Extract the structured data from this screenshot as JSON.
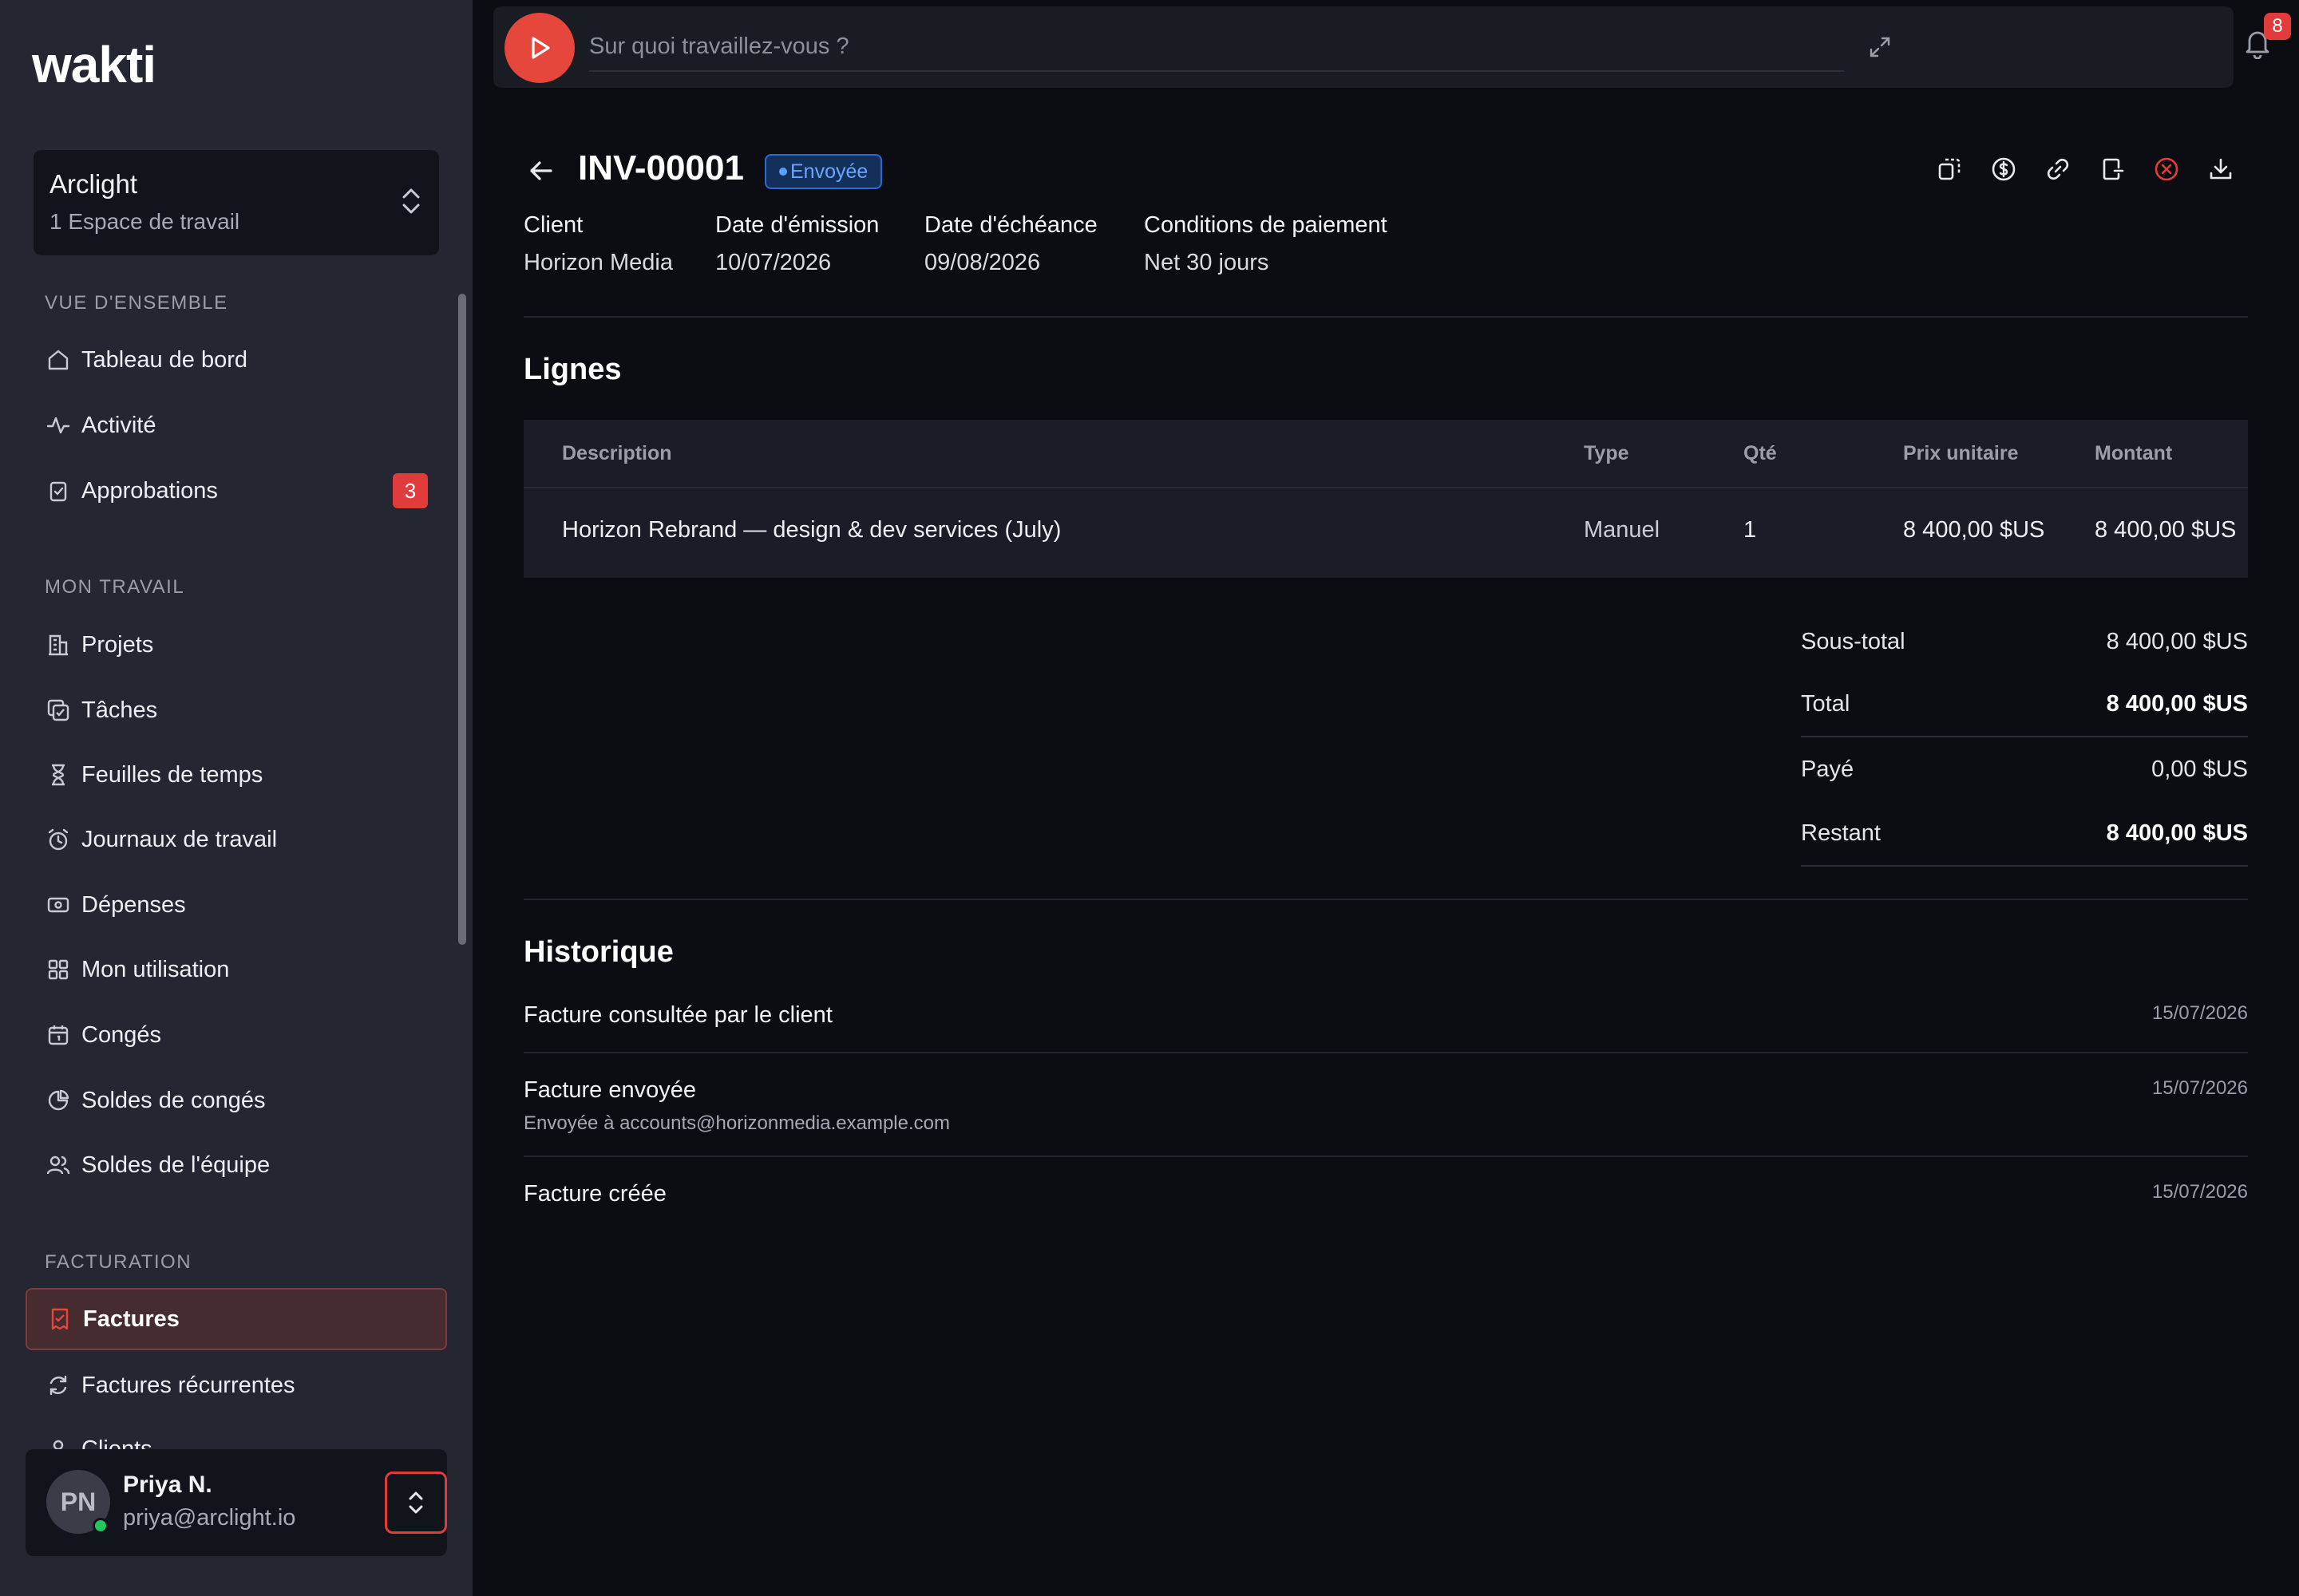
{
  "app": {
    "logo": "wakti"
  },
  "workspace": {
    "name": "Arclight",
    "subtitle": "1 Espace de travail"
  },
  "sidebar": {
    "sections": [
      {
        "title": "VUE D'ENSEMBLE"
      },
      {
        "title": "MON TRAVAIL"
      },
      {
        "title": "FACTURATION"
      }
    ],
    "items": [
      {
        "label": "Tableau de bord",
        "icon": "home-icon"
      },
      {
        "label": "Activité",
        "icon": "activity-icon"
      },
      {
        "label": "Approbations",
        "icon": "clipboard-check-icon",
        "badge": "3"
      },
      {
        "label": "Projets",
        "icon": "building-icon"
      },
      {
        "label": "Tâches",
        "icon": "tasks-icon"
      },
      {
        "label": "Feuilles de temps",
        "icon": "hourglass-icon"
      },
      {
        "label": "Journaux de travail",
        "icon": "alarm-clock-icon"
      },
      {
        "label": "Dépenses",
        "icon": "banknote-icon"
      },
      {
        "label": "Mon utilisation",
        "icon": "grid-icon"
      },
      {
        "label": "Congés",
        "icon": "calendar-icon"
      },
      {
        "label": "Soldes de congés",
        "icon": "pie-chart-icon"
      },
      {
        "label": "Soldes de l'équipe",
        "icon": "users-icon"
      },
      {
        "label": "Factures",
        "icon": "receipt-icon",
        "active": true
      },
      {
        "label": "Factures récurrentes",
        "icon": "refresh-icon"
      },
      {
        "label": "Clients",
        "icon": "client-icon"
      }
    ]
  },
  "user": {
    "initials": "PN",
    "name": "Priya N.",
    "email": "priya@arclight.io",
    "status_color": "#22c55e"
  },
  "topbar": {
    "search_placeholder": "Sur quoi travaillez-vous ?",
    "notifications_count": "8"
  },
  "invoice": {
    "number": "INV-00001",
    "status": "Envoyée",
    "meta": [
      {
        "label": "Client",
        "value": "Horizon Media"
      },
      {
        "label": "Date d'émission",
        "value": "10/07/2026"
      },
      {
        "label": "Date d'échéance",
        "value": "09/08/2026"
      },
      {
        "label": "Conditions de paiement",
        "value": "Net 30 jours"
      }
    ],
    "lines_title": "Lignes",
    "columns": [
      "Description",
      "Type",
      "Qté",
      "Prix unitaire",
      "Montant"
    ],
    "lines": [
      {
        "description": "Horizon Rebrand — design & dev services (July)",
        "type": "Manuel",
        "qty": "1",
        "unit_price": "8 400,00 $US",
        "amount": "8 400,00 $US"
      }
    ],
    "totals": [
      {
        "label": "Sous-total",
        "value": "8 400,00 $US"
      },
      {
        "label": "Total",
        "value": "8 400,00 $US"
      },
      {
        "label": "Payé",
        "value": "0,00 $US"
      },
      {
        "label": "Restant",
        "value": "8 400,00 $US"
      }
    ],
    "history_title": "Historique",
    "history": [
      {
        "title": "Facture consultée par le client",
        "subtitle": "",
        "date": "15/07/2026"
      },
      {
        "title": "Facture envoyée",
        "subtitle": "Envoyée à accounts@horizonmedia.example.com",
        "date": "15/07/2026"
      },
      {
        "title": "Facture créée",
        "subtitle": "",
        "date": "15/07/2026"
      }
    ]
  },
  "colors": {
    "accent": "#e5473c",
    "status_blue": "#6aa6ff",
    "danger": "#e23b3b"
  }
}
